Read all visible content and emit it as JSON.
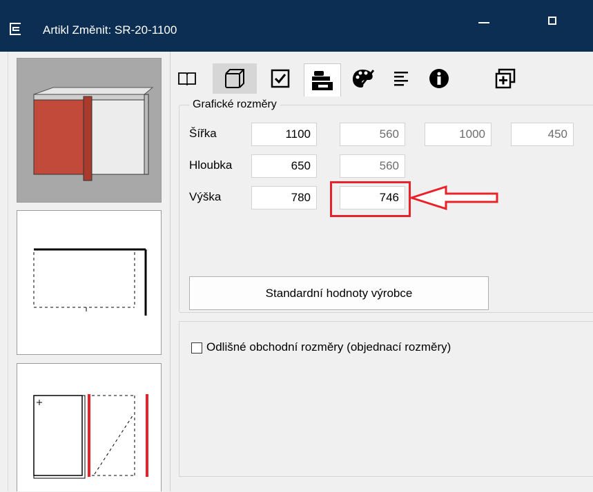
{
  "window": {
    "title": "Artikl Změnit: SR-20-1100"
  },
  "toolbar": {
    "icons": [
      "book-icon",
      "cube-icon",
      "checkbox-icon",
      "dimensions-icon",
      "palette-icon",
      "text-align-icon",
      "info-icon",
      "window-add-icon"
    ]
  },
  "dimensions": {
    "group_title": "Grafické rozměry",
    "rows": [
      {
        "label": "Šířka",
        "values": [
          "1100",
          "560",
          "1000",
          "450"
        ]
      },
      {
        "label": "Hloubka",
        "values": [
          "650",
          "560"
        ]
      },
      {
        "label": "Výška",
        "values": [
          "780",
          "746"
        ]
      }
    ],
    "std_button": "Standardní hodnoty výrobce"
  },
  "options": {
    "different_dims_label": "Odlišné obchodní rozměry (objednací rozměry)",
    "different_dims_checked": false
  },
  "colors": {
    "titlebar": "#0c2e52",
    "annotation_red": "#e8222a",
    "door_red": "#c0392b"
  }
}
